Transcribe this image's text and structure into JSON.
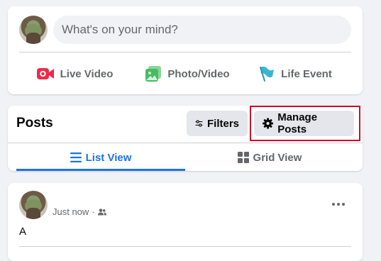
{
  "composer": {
    "placeholder": "What's on your mind?",
    "actions": [
      {
        "label": "Live Video",
        "icon": "live-video-icon",
        "color": "#f02849"
      },
      {
        "label": "Photo/Video",
        "icon": "photo-icon",
        "color": "#45bd62"
      },
      {
        "label": "Life Event",
        "icon": "flag-icon",
        "color": "#3ab5d1"
      }
    ]
  },
  "posts": {
    "title": "Posts",
    "filters_label": "Filters",
    "manage_label": "Manage Posts",
    "tabs": [
      {
        "label": "List View",
        "icon": "list-icon",
        "active": true
      },
      {
        "label": "Grid View",
        "icon": "grid-icon",
        "active": false
      }
    ]
  },
  "post": {
    "time": "Just now",
    "audience_icon": "friends-icon",
    "text": "A"
  },
  "colors": {
    "accent": "#1b74e4",
    "highlight_box": "#c8102e"
  }
}
